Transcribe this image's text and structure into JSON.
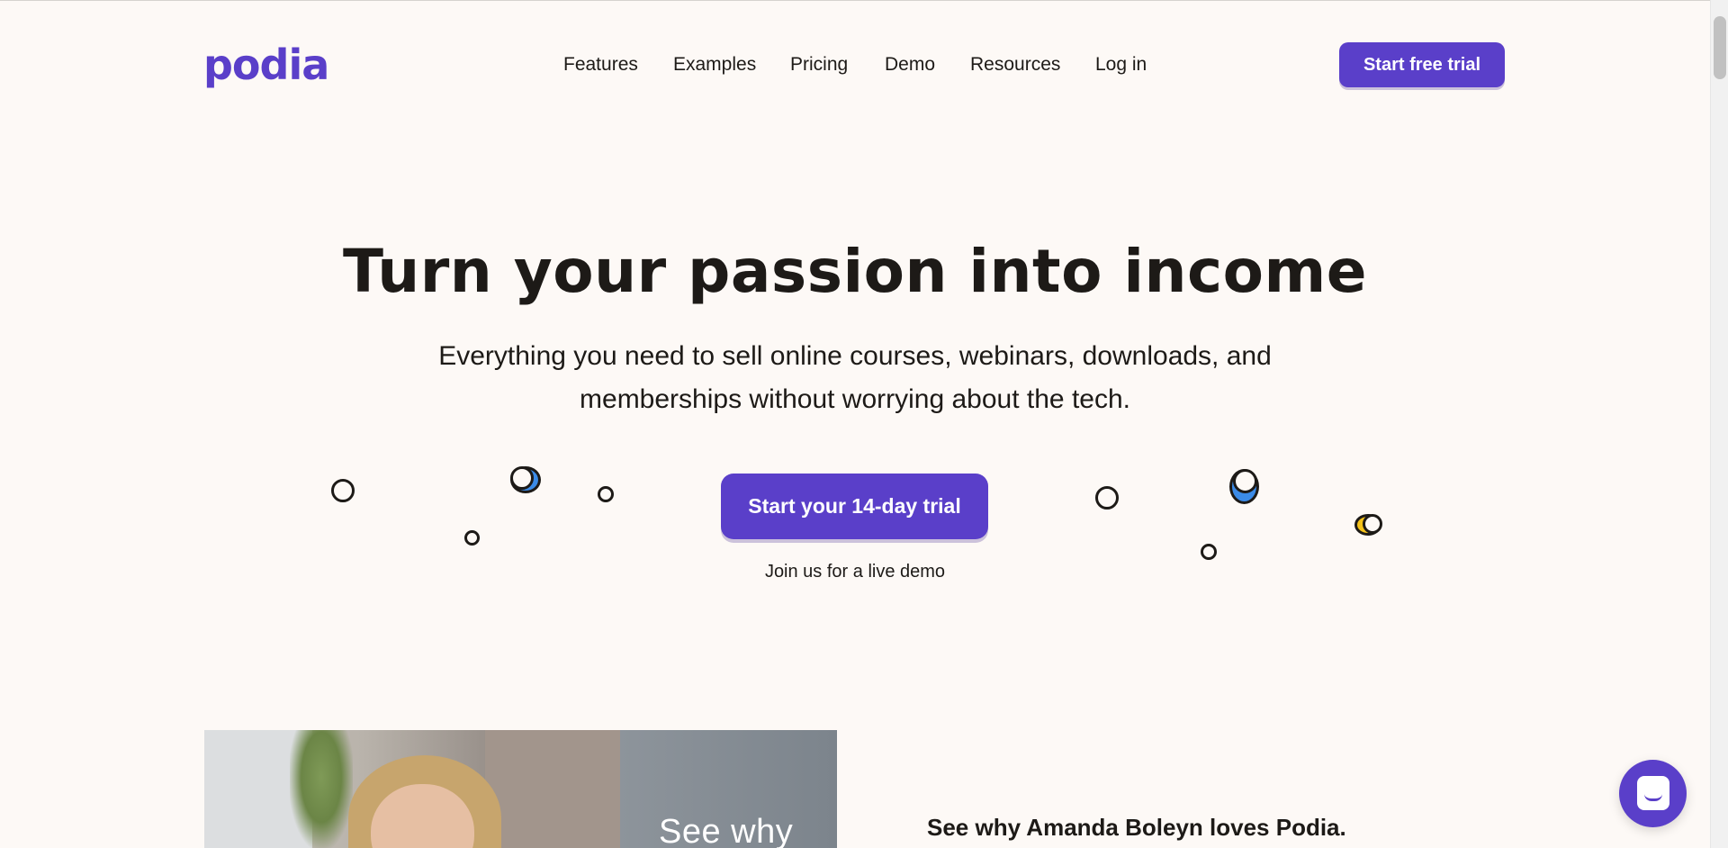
{
  "header": {
    "logo": "podia",
    "nav": [
      {
        "label": "Features",
        "name": "nav-features"
      },
      {
        "label": "Examples",
        "name": "nav-examples"
      },
      {
        "label": "Pricing",
        "name": "nav-pricing"
      },
      {
        "label": "Demo",
        "name": "nav-demo"
      },
      {
        "label": "Resources",
        "name": "nav-resources"
      },
      {
        "label": "Log in",
        "name": "nav-login"
      }
    ],
    "cta_label": "Start free trial"
  },
  "hero": {
    "title": "Turn your passion into income",
    "subtitle": "Everything you need to sell online courses, webinars, downloads, and memberships without worrying about the tech.",
    "cta_label": "Start your 14-day trial",
    "demo_link": "Join us for a live demo"
  },
  "testimonial": {
    "video_caption": "See why",
    "heading": "See why Amanda Boleyn loves Podia."
  },
  "chat": {
    "icon": "chat-icon"
  },
  "colors": {
    "brand": "#5a3fc9",
    "background": "#fdf9f6",
    "text": "#1d1a17",
    "accent_blue": "#3b8be8",
    "accent_yellow": "#f4c21a"
  }
}
